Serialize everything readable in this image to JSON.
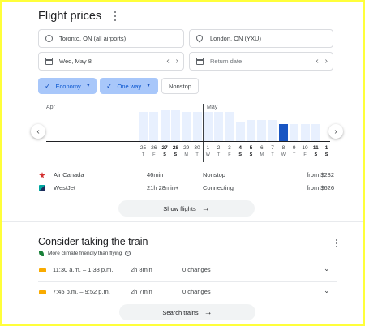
{
  "header": {
    "title": "Flight prices",
    "more_icon": "more-vert-icon"
  },
  "search": {
    "origin": "Toronto, ON (all airports)",
    "destination": "London, ON (YXU)",
    "depart_date": "Wed, May 8",
    "return_date_placeholder": "Return date",
    "prev": "‹",
    "next": "›"
  },
  "filters": {
    "cabin": "Economy",
    "trip_type": "One way",
    "stops": "Nonstop",
    "check": "✓",
    "caret": "▼"
  },
  "calendar": {
    "month_left": "Apr",
    "month_right": "May",
    "nav_prev": "‹",
    "nav_next": "›",
    "days": [
      {
        "num": "25",
        "letter": "T",
        "bold": false
      },
      {
        "num": "26",
        "letter": "F",
        "bold": false
      },
      {
        "num": "27",
        "letter": "S",
        "bold": true
      },
      {
        "num": "28",
        "letter": "S",
        "bold": true
      },
      {
        "num": "29",
        "letter": "M",
        "bold": false
      },
      {
        "num": "30",
        "letter": "T",
        "bold": false
      },
      {
        "num": "1",
        "letter": "W",
        "bold": false
      },
      {
        "num": "2",
        "letter": "T",
        "bold": false
      },
      {
        "num": "3",
        "letter": "F",
        "bold": false
      },
      {
        "num": "4",
        "letter": "S",
        "bold": true
      },
      {
        "num": "5",
        "letter": "S",
        "bold": true
      },
      {
        "num": "6",
        "letter": "M",
        "bold": false
      },
      {
        "num": "7",
        "letter": "T",
        "bold": false
      },
      {
        "num": "8",
        "letter": "W",
        "bold": false
      },
      {
        "num": "9",
        "letter": "T",
        "bold": false
      },
      {
        "num": "10",
        "letter": "F",
        "bold": false
      },
      {
        "num": "11",
        "letter": "S",
        "bold": true
      },
      {
        "num": "1",
        "letter": "S",
        "bold": true
      }
    ],
    "price_levels": [
      0.86,
      0.86,
      0.9,
      0.9,
      0.86,
      0.86,
      0.86,
      0.86,
      0.86,
      0.57,
      0.61,
      0.61,
      0.61,
      0.49,
      0.49,
      0.49,
      0.49,
      0.49
    ],
    "selected_index": 13
  },
  "flights": [
    {
      "airline": "Air Canada",
      "duration": "46min",
      "stops": "Nonstop",
      "price": "from $282",
      "logo": "air-canada-logo-icon"
    },
    {
      "airline": "WestJet",
      "duration": "21h 28min+",
      "stops": "Connecting",
      "price": "from $626",
      "logo": "westjet-logo-icon"
    }
  ],
  "show_flights": {
    "label": "Show flights",
    "arrow": "→"
  },
  "train": {
    "title": "Consider taking the train",
    "eco_note": "More climate friendly than flying",
    "info": "i",
    "rows": [
      {
        "time": "11:30 a.m. – 1:38 p.m.",
        "duration": "2h 8min",
        "changes": "0 changes"
      },
      {
        "time": "7:45 p.m. – 9:52 p.m.",
        "duration": "2h 7min",
        "changes": "0 changes"
      }
    ],
    "expand": "⌄",
    "search_label": "Search trains",
    "arrow": "→"
  },
  "colors": {
    "frame": "#ffff3a",
    "accent": "#1a56c2",
    "chip_selected": "#a8c7fa",
    "bar": "#e8f0fe",
    "eco_green": "#188038"
  }
}
